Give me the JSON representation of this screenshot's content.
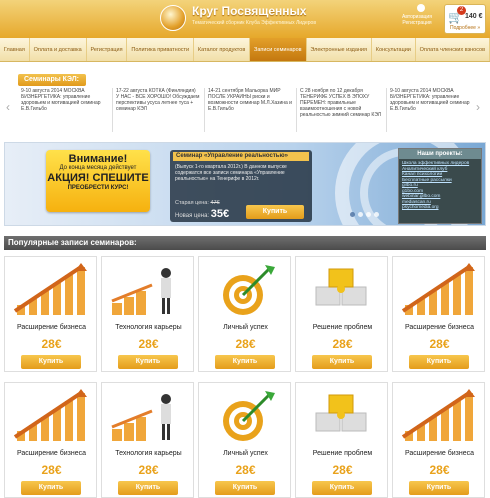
{
  "header": {
    "title": "Круг Посвященных",
    "subtitle": "Тематический сборник Клуба Эффективных Лидеров",
    "auth_login": "Авторизация",
    "auth_register": "Регистрация",
    "cart": {
      "count": "2",
      "price": "140 €",
      "more": "Подробнее »"
    }
  },
  "nav": {
    "items": [
      "Главная",
      "Оплата и доставка",
      "Регистрация",
      "Политика приватности",
      "Каталог продуктов",
      "Записи семинаров",
      "Электронные издания",
      "Консультации",
      "Оплата членских взносов"
    ]
  },
  "seminars": {
    "label": "Семинары КЭЛ:",
    "cards": [
      "9-10 августа 2014 МОСКВА БИЗНЕРГЕТИКА: управление здоровьем и мотивацией семинар Е.В.Гильбо",
      "17-22 августа КОТКА (Финляндия) У НАС - ВСЕ ХОРОШО! Обсуждаем перспективы усуса летнее туса + семинар КЭЛ",
      "14-21 сентября Мальорка МИР ПОСЛЕ УКРАИНЫ риски и возможности семинар М.Л.Хазина и Е.В.Гильбо",
      "С 28 ноября по 12 декабря ТЕНЕРИФЕ УСПЕХ В ЭПОХУ ПЕРЕМЕН: правильные взаимоотношения с новой реальностью зимний семинар КЭЛ",
      "9-10 августа 2014 МОСКВА БИЗНЕРГЕТИКА: управление здоровьем и мотивацией семинар Е.В.Гильбо"
    ]
  },
  "banner": {
    "promo_title": "Внимание!",
    "promo_sub": "До конца месяца действует",
    "promo_big": "АКЦИЯ! СПЕШИТЕ",
    "promo_small": "ПРЕОБРЕСТИ КУРС!",
    "course_title": "Семинар «Управление реальностью»",
    "course_desc": "(Выпуск 1-го квартала 2012г.) В данном выпуске содержатся все записи семинара «Управление реальностью» на Тенерифе в 2012г.",
    "old_price_label": "Старая цена:",
    "old_price": "47€",
    "new_price_label": "Новая цена:",
    "new_price": "35€",
    "buy": "Купить"
  },
  "projects": {
    "title": "Наши проекты:",
    "links": [
      "Школа эффективных лидеров",
      "Аналитический клуб",
      "Канал психологии",
      "Бесплатные рассылки",
      "gilbo.ru",
      "g1bo.com",
      "webinar.gilbo.com",
      "mediascan.ru",
      "psychomedia.org"
    ]
  },
  "popular": {
    "title": "Популярные записи семинаров:",
    "products": [
      {
        "name": "Расширение бизнеса",
        "price": "28€",
        "buy": "Купить",
        "icon": "growth-chart-icon"
      },
      {
        "name": "Технология карьеры",
        "price": "28€",
        "buy": "Купить",
        "icon": "career-man-icon"
      },
      {
        "name": "Личный успех",
        "price": "28€",
        "buy": "Купить",
        "icon": "target-dart-icon"
      },
      {
        "name": "Решение проблем",
        "price": "28€",
        "buy": "Купить",
        "icon": "puzzle-icon"
      },
      {
        "name": "Расширение бизнеса",
        "price": "28€",
        "buy": "Купить",
        "icon": "growth-chart-icon"
      },
      {
        "name": "Расширение бизнеса",
        "price": "28€",
        "buy": "Купить",
        "icon": "growth-chart-icon"
      },
      {
        "name": "Технология карьеры",
        "price": "28€",
        "buy": "Купить",
        "icon": "career-man-icon"
      },
      {
        "name": "Личный успех",
        "price": "28€",
        "buy": "Купить",
        "icon": "target-dart-icon"
      },
      {
        "name": "Решение проблем",
        "price": "28€",
        "buy": "Купить",
        "icon": "puzzle-icon"
      },
      {
        "name": "Расширение бизнеса",
        "price": "28€",
        "buy": "Купить",
        "icon": "growth-chart-icon"
      }
    ]
  }
}
